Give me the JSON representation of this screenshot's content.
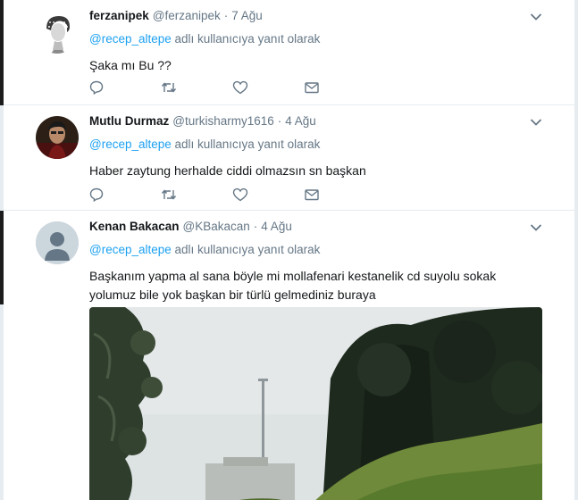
{
  "tweets": [
    {
      "fullname": "ferzanipek",
      "username": "@ferzanipek",
      "separator": "·",
      "time": "7 Ağu",
      "reply_mention": "@recep_altepe",
      "reply_text": " adlı kullanıcıya yanıt olarak",
      "text": "Şaka mı Bu ??",
      "avatar_icon": "statue-bust-avatar",
      "has_media": false
    },
    {
      "fullname": "Mutlu Durmaz",
      "username": "@turkisharmy1616",
      "separator": "·",
      "time": "4 Ağu",
      "reply_mention": "@recep_altepe",
      "reply_text": " adlı kullanıcıya yanıt olarak",
      "text": "Haber zaytung herhalde ciddi olmazsın sn başkan",
      "avatar_icon": "person-photo-avatar",
      "has_media": false
    },
    {
      "fullname": "Kenan Bakacan",
      "username": "@KBakacan",
      "separator": "·",
      "time": "4 Ağu",
      "reply_mention": "@recep_altepe",
      "reply_text": " adlı kullanıcıya yanıt olarak",
      "text": "Başkanım yapma al sana böyle mi mollafenari kestanelik cd suyolu sokak yolumuz bile yok başkan bir türlü gelmediniz buraya",
      "avatar_icon": "default-profile-avatar",
      "has_media": true,
      "media_icon": "forest-road-photo"
    }
  ],
  "action_icons": [
    "reply-icon",
    "retweet-icon",
    "like-icon",
    "direct-message-icon"
  ],
  "colors": {
    "link": "#1da1f2",
    "secondary_text": "#657786",
    "primary_text": "#14171a",
    "divider": "#e6ecf0"
  }
}
